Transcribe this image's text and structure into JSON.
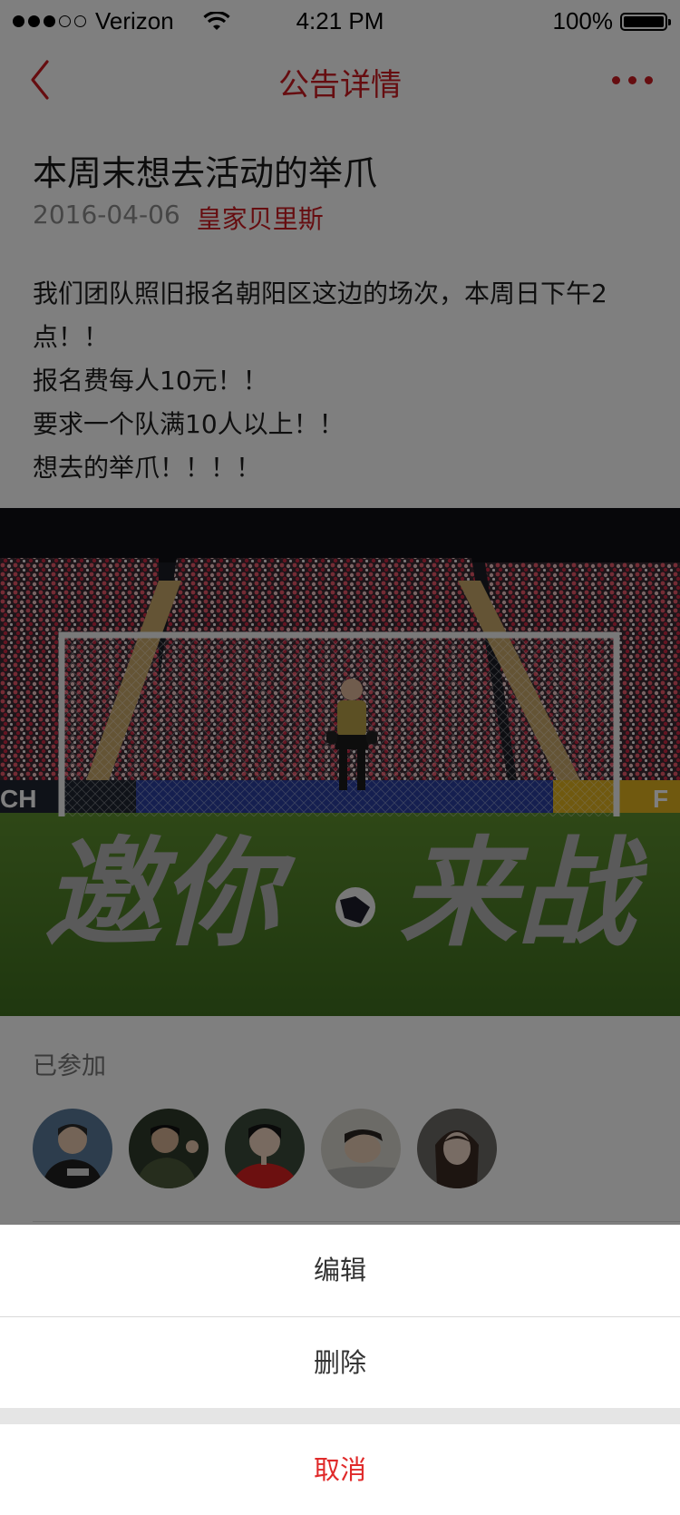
{
  "status_bar": {
    "carrier": "Verizon",
    "time": "4:21 PM",
    "battery": "100%",
    "signal_icon": "signal-dots-icon",
    "wifi_icon": "wifi-icon",
    "battery_icon": "battery-icon"
  },
  "nav": {
    "title": "公告详情",
    "back_icon": "chevron-left-icon",
    "more_icon": "more-dots-icon"
  },
  "post": {
    "title": "本周末想去活动的举爪",
    "date": "2016-04-06",
    "club": "皇家贝里斯",
    "lines": [
      "我们团队照旧报名朝阳区这边的场次，本周日下午2点！！",
      "报名费每人10元！！",
      "要求一个队满10人以上！！",
      "想去的举爪！！！！"
    ]
  },
  "banner": {
    "text_left": "邀你",
    "text_right": "来战",
    "board_left": "CH",
    "board_right": "F"
  },
  "participants": {
    "label": "已参加",
    "count": 5
  },
  "action_sheet": {
    "edit": "编辑",
    "delete": "删除",
    "cancel": "取消"
  },
  "colors": {
    "accent": "#cc1b21",
    "cancel": "#e02a2a",
    "overlay": "rgba(0,0,0,0.5)"
  }
}
